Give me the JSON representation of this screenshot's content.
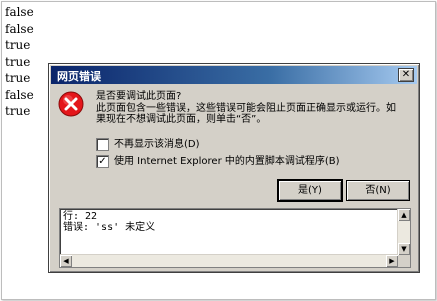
{
  "console": {
    "lines": [
      "false",
      "false",
      "true",
      "true",
      "true",
      "false",
      "true"
    ]
  },
  "dialog": {
    "title": "网页错误",
    "close_glyph": "✕",
    "icon": "error-icon",
    "message": {
      "line1": "是否要调试此页面?",
      "line2": "此页面包含一些错误，这些错误可能会阻止页面正确显示或运行。如",
      "line3": "果现在不想调试此页面，则单击“否”。"
    },
    "checkbox_dont_show": {
      "label": "不再显示该消息(D)",
      "checked": false,
      "mark": ""
    },
    "checkbox_use_debugger": {
      "label": "使用 Internet Explorer 中的内置脚本调试程序(B)",
      "checked": true,
      "mark": "✓"
    },
    "yes_label": "是(Y)",
    "no_label": "否(N)",
    "detail": {
      "line1": "行: 22",
      "line2": "错误: 'ss' 未定义"
    }
  },
  "colors": {
    "dialog_bg": "#d4d0c8",
    "title_gradient_start": "#0a246a",
    "error_red": "#e4161b"
  }
}
